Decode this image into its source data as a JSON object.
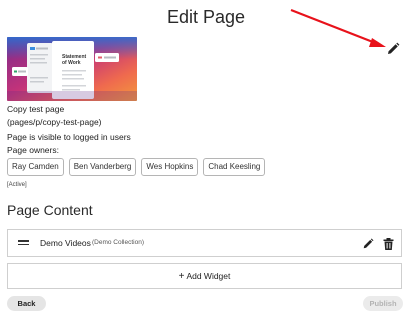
{
  "header": {
    "title": "Edit Page"
  },
  "thumbnail": {
    "card_title": "Statement of Work"
  },
  "page_info": {
    "name": "Copy test page",
    "path": "(pages/p/copy-test-page)",
    "visibility": "Page is visible to logged in users",
    "owners_label": "Page owners:"
  },
  "owners": [
    "Ray Camden",
    "Ben Vanderberg",
    "Wes Hopkins",
    "Chad Keesling"
  ],
  "status": "[Active]",
  "content": {
    "title": "Page Content",
    "widgets": [
      {
        "name": "Demo Videos",
        "type": "(Demo Collection)"
      }
    ],
    "add_widget_label": "Add Widget"
  },
  "footer": {
    "back_label": "Back",
    "publish_label": "Publish"
  },
  "colors": {
    "annotation_arrow": "#e8121b",
    "publish_disabled_text": "#b3b3b3"
  },
  "icons": {
    "edit_page": "pencil-icon",
    "widget_drag": "drag-handle-icon",
    "widget_edit": "pencil-icon",
    "widget_delete": "trash-icon",
    "add_widget": "plus-icon"
  }
}
